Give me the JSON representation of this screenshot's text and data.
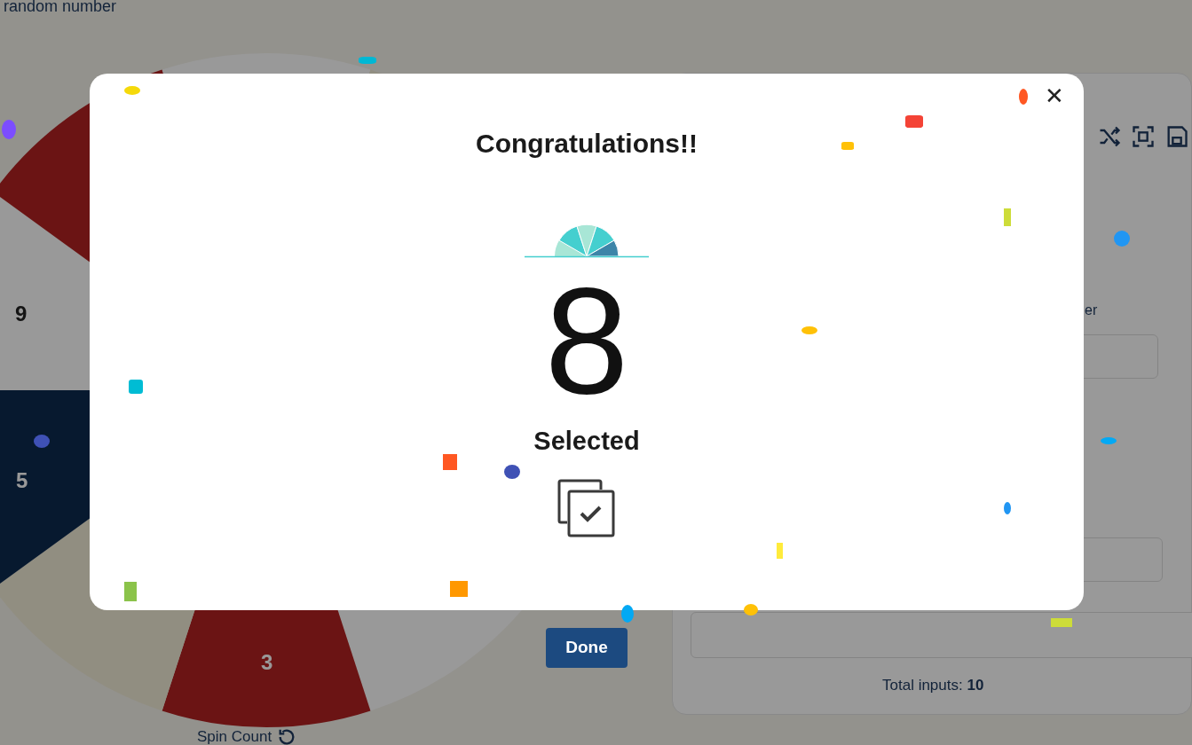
{
  "background": {
    "heading_fragment": "random number",
    "wheel_labels": [
      "9",
      "5",
      "3"
    ],
    "field_label_fragment": "er",
    "total_inputs_label": "Total inputs:",
    "total_inputs_value": "10",
    "spin_count_label": "Spin Count"
  },
  "dialog": {
    "title": "Congratulations!!",
    "result": "8",
    "result_caption": "Selected",
    "close_glyph": "✕"
  },
  "done_button": "Done"
}
